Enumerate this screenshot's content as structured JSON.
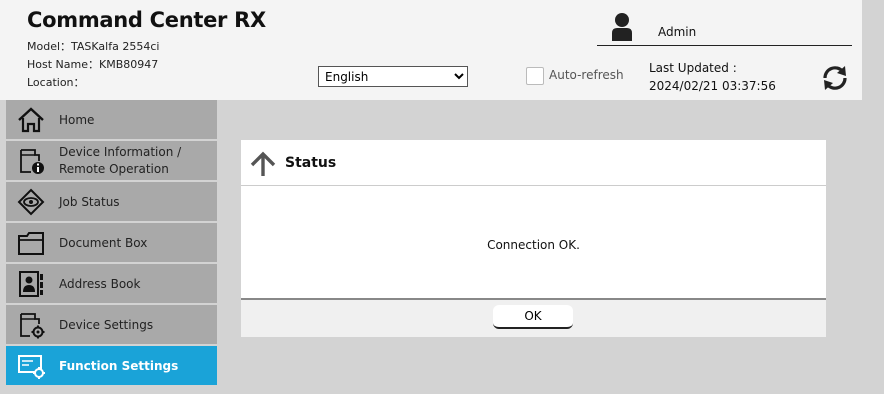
{
  "header": {
    "title": "Command Center RX",
    "model": "Model：TASKalfa 2554ci",
    "host": "Host Name：KMB80947",
    "location": "Location：",
    "user": "Admin",
    "language": "English",
    "auto_refresh": "Auto-refresh",
    "last_updated_label": "Last Updated :",
    "last_updated_value": "2024/02/21 03:37:56"
  },
  "sidebar": {
    "items": [
      {
        "label": "Home",
        "icon": "home-icon"
      },
      {
        "label": "Device Information /",
        "label2": "Remote Operation",
        "icon": "device-info-icon"
      },
      {
        "label": "Job Status",
        "icon": "job-status-icon"
      },
      {
        "label": "Document Box",
        "icon": "document-box-icon"
      },
      {
        "label": "Address Book",
        "icon": "address-book-icon"
      },
      {
        "label": "Device Settings",
        "icon": "device-settings-icon"
      },
      {
        "label": "Function Settings",
        "icon": "function-settings-icon",
        "active": true
      }
    ]
  },
  "dialog": {
    "title": "Status",
    "message": "Connection OK.",
    "ok_label": "OK"
  },
  "colors": {
    "active_nav": "#1aa3d8",
    "nav": "#a9a9a9",
    "background": "#d3d3d3"
  }
}
